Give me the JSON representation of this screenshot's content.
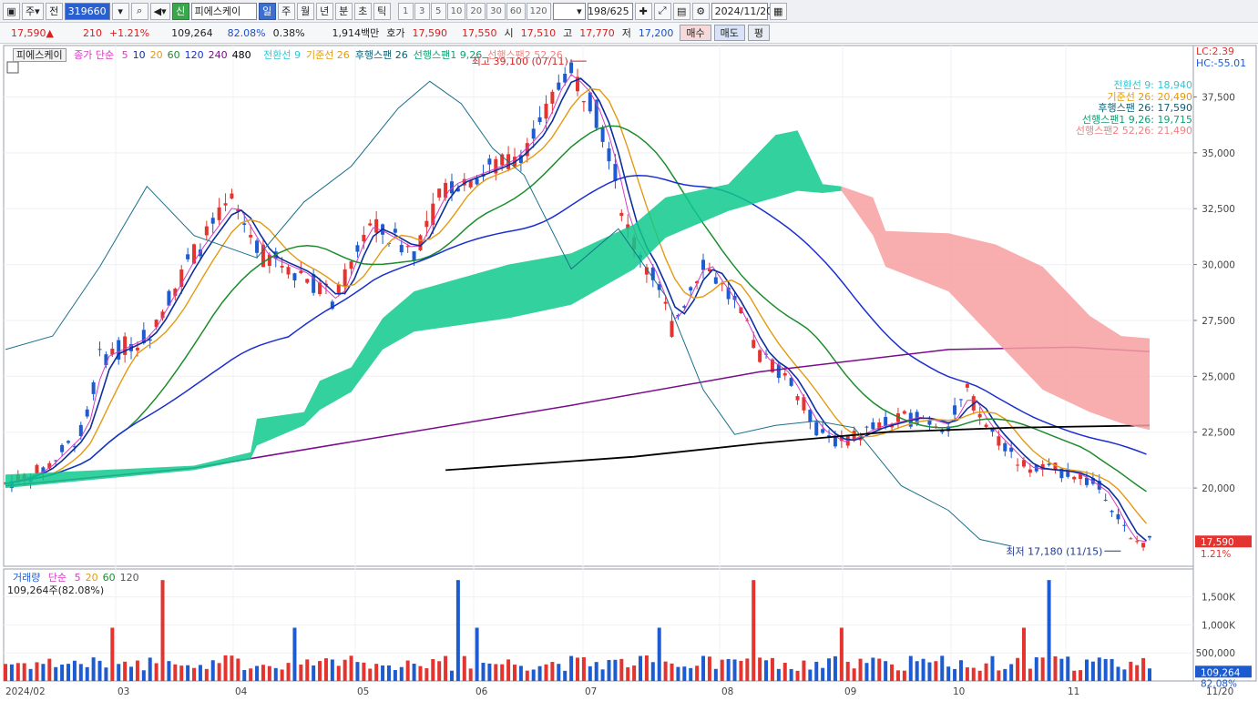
{
  "toolbar": {
    "market": "주",
    "prev": "전",
    "code": "319660",
    "sin_label": "신",
    "stock_name": "피에스케이",
    "periods": [
      "일",
      "주",
      "월",
      "년",
      "분",
      "초",
      "틱"
    ],
    "active_period": "일",
    "intervals": [
      "1",
      "3",
      "5",
      "10",
      "20",
      "30",
      "60",
      "120"
    ],
    "counter": "198/625",
    "date": "2024/11/20"
  },
  "quote": {
    "price": "17,590",
    "change_arrow": "▲",
    "change": "210",
    "change_pct": "+1.21%",
    "volume": "109,264",
    "vol_ratio": "82.08%",
    "turnover": "0.38%",
    "amount": "1,914백만",
    "hoga_label": "호가",
    "ask": "17,590",
    "bid": "17,550",
    "open_label": "시",
    "open": "17,510",
    "high_label": "고",
    "high": "17,770",
    "low_label": "저",
    "low": "17,200",
    "buy_label": "매수",
    "sell_label": "매도",
    "pyeong_label": "평"
  },
  "legend": {
    "name": "피에스케이",
    "ma_title": "종가 단순",
    "ma_periods": [
      "5",
      "10",
      "20",
      "60",
      "120",
      "240",
      "480"
    ],
    "ichimoku": [
      "전환선 9",
      "기준선 26",
      "후행스팬 26",
      "선행스팬1 9,26",
      "선행스팬2 52,26"
    ],
    "lc": "LC:2.39",
    "hc": "HC:-55.01",
    "ichi_values": [
      "전환선 9: 18,940",
      "기준선 26: 20,490",
      "후행스팬 26: 17,590",
      "선행스팬1 9,26: 19,715",
      "선행스팬2 52,26: 21,490"
    ]
  },
  "annotations": {
    "max": "최고 39,100 (07/11)",
    "min": "최저 17,180 (11/15)",
    "current_price": "17,590",
    "current_pct": "1.21%"
  },
  "volume_panel": {
    "title": "거래량",
    "ma_title": "단순",
    "ma_periods": [
      "5",
      "20",
      "60",
      "120"
    ],
    "info": "109,264주(82.08%)",
    "current": "109,264",
    "current_pct": "82.08%",
    "y_labels": [
      "1,500K",
      "1,000K",
      "500,000"
    ]
  },
  "price_axis": [
    "37,500",
    "35,000",
    "32,500",
    "30,000",
    "27,500",
    "25,000",
    "22,500",
    "20,000"
  ],
  "x_axis": [
    "2024/02",
    "03",
    "04",
    "05",
    "06",
    "07",
    "08",
    "09",
    "10",
    "11",
    "11/20"
  ],
  "colors": {
    "up": "#e3342f",
    "down": "#1d5bd1",
    "cloud_green": "#0fc98c",
    "cloud_red": "#f7a0a0",
    "ma5": "#d63cc0",
    "ma10": "#0b2f9c",
    "ma20": "#e39a12",
    "ma60": "#1c8c2c",
    "ma120": "#1a2fd0",
    "ma240": "#7a0b8c",
    "ma480": "#000000"
  },
  "chart_data": {
    "type": "candlestick",
    "y_range": [
      16500,
      39800
    ],
    "max_point": {
      "date": "07/11",
      "value": 39100
    },
    "min_point": {
      "date": "11/15",
      "value": 17180
    },
    "last_close": 17590
  }
}
